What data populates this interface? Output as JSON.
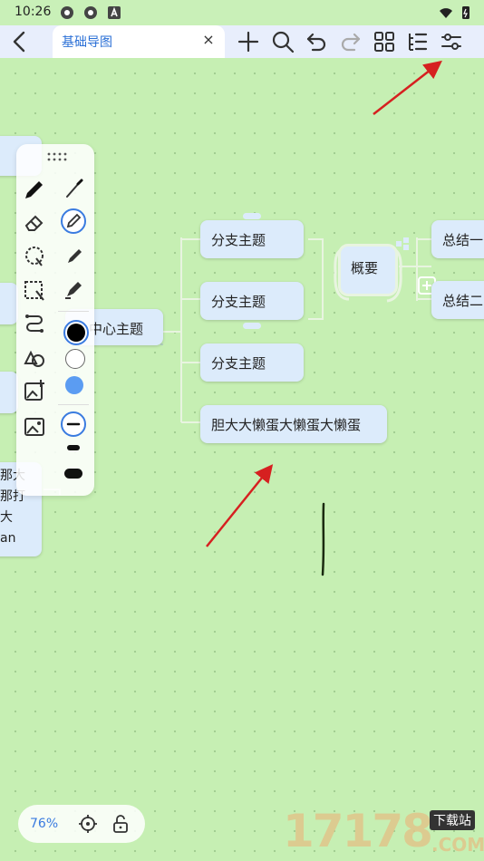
{
  "status_bar": {
    "time": "10:26"
  },
  "header": {
    "tab_title": "基础导图",
    "tab_close": "×"
  },
  "toolbar_icons": [
    "back-icon",
    "add-icon",
    "search-icon",
    "undo-icon",
    "redo-icon",
    "layout-icon",
    "outline-icon",
    "settings-sliders-icon"
  ],
  "mindmap": {
    "central": "中心主题",
    "branches": [
      "分支主题",
      "分支主题",
      "分支主题",
      "胆大大懒蛋大懒蛋大懒蛋"
    ],
    "summary": "概要",
    "summary_children": [
      "总结一",
      "总结二"
    ],
    "left_partial_text": [
      "那大",
      "那打",
      "大",
      "an"
    ]
  },
  "draw_panel": {
    "tools": [
      "pen-icon",
      "eraser-icon",
      "lasso-icon",
      "select-icon",
      "connector-icon",
      "shapes-icon",
      "insert-image-icon",
      "image-icon"
    ],
    "brushes": [
      "brush-thin-icon",
      "pencil-icon",
      "marker-icon",
      "highlighter-icon"
    ],
    "colors": [
      "#000000",
      "#ffffff",
      "#5b9cf2"
    ],
    "stroke_sizes": [
      "thin",
      "medium",
      "thick"
    ]
  },
  "zoom": {
    "value": "76%"
  },
  "watermark": {
    "text": "17178",
    "sub": "下载站",
    "domain": ".COM"
  },
  "colors": {
    "accent": "#2a6fd6",
    "canvas": "#c6efb3",
    "node_fill": "#dcebfb",
    "arrow": "#d62020"
  }
}
